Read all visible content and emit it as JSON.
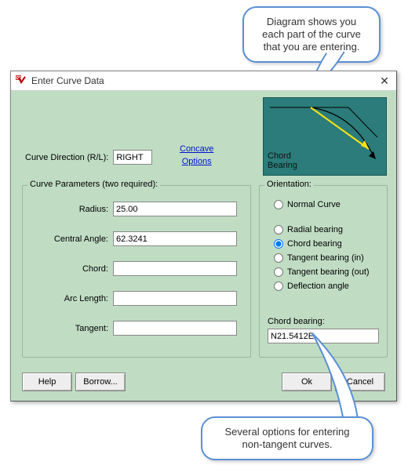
{
  "callouts": {
    "top": "Diagram shows you each part of the curve that you are entering.",
    "bottom": "Several options for entering non-tangent curves."
  },
  "window": {
    "title": "Enter Curve Data"
  },
  "diagram": {
    "label_line1": "Chord",
    "label_line2": "Bearing"
  },
  "curve_direction": {
    "label": "Curve Direction (R/L):",
    "value": "RIGHT"
  },
  "links": {
    "concave": "Concave",
    "options": "Options"
  },
  "params": {
    "title": "Curve Parameters (two required):",
    "radius_label": "Radius:",
    "radius_value": "25.00",
    "central_angle_label": "Central Angle:",
    "central_angle_value": "62.3241",
    "chord_label": "Chord:",
    "chord_value": "",
    "arc_length_label": "Arc Length:",
    "arc_length_value": "",
    "tangent_label": "Tangent:",
    "tangent_value": ""
  },
  "orientation": {
    "title": "Orientation:",
    "options": {
      "normal": "Normal Curve",
      "radial": "Radial bearing",
      "chord": "Chord bearing",
      "tangent_in": "Tangent bearing (in)",
      "tangent_out": "Tangent bearing (out)",
      "deflection": "Deflection angle"
    },
    "selected": "chord",
    "field_label": "Chord bearing:",
    "field_value": "N21.5412E"
  },
  "buttons": {
    "help": "Help",
    "borrow": "Borrow...",
    "ok": "Ok",
    "cancel": "Cancel"
  }
}
